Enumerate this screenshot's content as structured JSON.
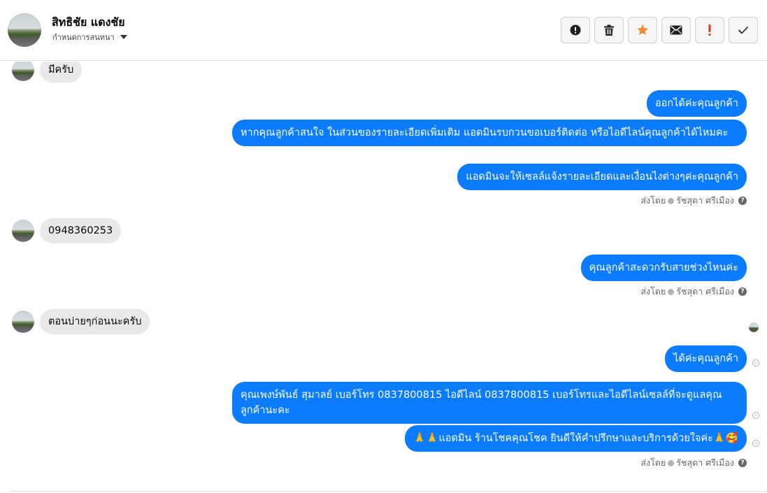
{
  "header": {
    "contact_name": "สิทธิชัย แดงชัย",
    "tag_label": "กำหนดการสนทนา",
    "toolbar": [
      {
        "name": "report-button",
        "icon": "alert-circle-icon"
      },
      {
        "name": "delete-button",
        "icon": "trash-icon"
      },
      {
        "name": "star-button",
        "icon": "star-icon",
        "color": "#f28c28"
      },
      {
        "name": "mail-button",
        "icon": "envelope-icon"
      },
      {
        "name": "important-button",
        "icon": "exclamation-icon",
        "color": "#e0361a"
      },
      {
        "name": "done-button",
        "icon": "check-icon"
      }
    ]
  },
  "messages": {
    "m1": "มีครับ",
    "m2": "ออกได้ค่ะคุณลูกค้า",
    "m3": "หากคุณลูกค้าสนใจ ในส่วนของรายละเอียดเพิ่มเติม แอดมินรบกวนขอเบอร์ติดต่อ หรือไอดีไลน์คุณลูกค้าได้ไหมคะ",
    "m4": "แอดมินจะให้เซลล์แจ้งรายละเอียดและเงื่อนไงต่างๆค่ะคุณลูกค้า",
    "m5": "0948360253",
    "m6": "คุณลูกค้าสะดวกรับสายช่วงไหนค่ะ",
    "m7": "ตอนบ่ายๆก่อนนะครับ",
    "m8": "ได้ค่ะคุณลูกค้า",
    "m9": "คุณเพงษ์พันธ์ สุมาลย์      เบอร์โทร 0837800815  ไอดีไลน์ 0837800815   เบอร์โทรและไอดีไลน์เซลล์ที่จะดูแลคุณลูกค้านะคะ",
    "m10": "🙏🙏แอดมิน ร้านโชคคุณโชค ยินดีให้คำปรึกษาและบริการด้วยใจค่ะ🙏🥰"
  },
  "sent_by": {
    "prefix": "ส่งโดย",
    "agent": "รัชสุดา ศรีเมือง"
  },
  "colors": {
    "outgoing_bubble": "#0b7cff",
    "incoming_bubble": "#e9e9eb"
  }
}
